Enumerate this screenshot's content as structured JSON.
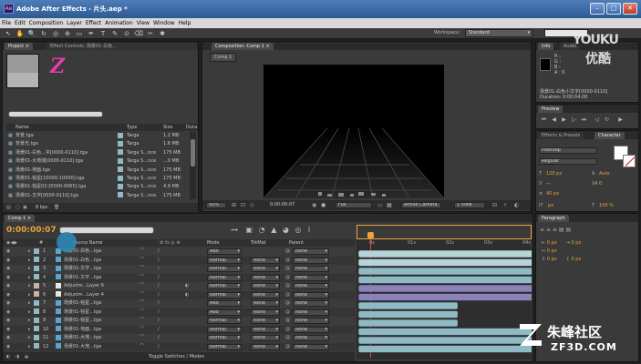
{
  "window": {
    "title": "Adobe After Effects - 片头.aep *",
    "app_icon": "Ae"
  },
  "menubar": {
    "items": [
      "File",
      "Edit",
      "Composition",
      "Layer",
      "Effect",
      "Animation",
      "View",
      "Window",
      "Help"
    ]
  },
  "toolbar": {
    "workspace_label": "Workspace:",
    "workspace_value": "Standard",
    "icons": [
      "selection-icon",
      "hand-icon",
      "zoom-icon",
      "rotate-icon",
      "camera-icon",
      "pan-behind-icon",
      "mask-icon",
      "pen-icon",
      "text-icon",
      "brush-icon",
      "clone-icon",
      "eraser-icon",
      "roto-icon",
      "puppet-icon"
    ]
  },
  "project_panel": {
    "tabs": [
      "Project ×",
      "Effect Controls: 场景01-白色..."
    ],
    "preview_glyph": "Z",
    "columns": [
      "Name",
      "Type",
      "Size",
      "Dura"
    ],
    "items": [
      {
        "name": "背景.tga",
        "type": "Targa",
        "size": "1.2 MB"
      },
      {
        "name": "背景光.tga",
        "type": "Targa",
        "size": "1.6 MB"
      },
      {
        "name": "场景01-白色...字[0000-0110].tga",
        "type": "Targa S...nce",
        "size": "175 MB"
      },
      {
        "name": "场景01-大地球[0000-0110].tga",
        "type": "Targa S...nce",
        "size": "...0 MB"
      },
      {
        "name": "场景01-地面.tga",
        "type": "Targa S...nce",
        "size": "175 MB"
      },
      {
        "name": "场景01-铭星[10000-10000].tga",
        "type": "Targa S...nce",
        "size": "175 MB"
      },
      {
        "name": "场景01-铭星02-[0000-0065].tga",
        "type": "Targa S...nce",
        "size": "4.9 MB"
      },
      {
        "name": "场景01-文字[0000-0110].tga",
        "type": "Targa S...nce",
        "size": "175 MB"
      }
    ],
    "footer_bpc": "8 bpc"
  },
  "composition_panel": {
    "tab": "Composition: Comp 1 ×",
    "sub_tab": "Comp 1",
    "zoom": "50%",
    "timecode": "0:00:00:07",
    "resolution": "Full",
    "camera": "Active Camera",
    "views": "1 View"
  },
  "info_panel": {
    "tabs": [
      "Info",
      "Audio"
    ],
    "lines": [
      "R :",
      "G :",
      "B :",
      "A : 0"
    ],
    "layer_name": "场景01-白色小文字[0000-0110]",
    "duration": "Duration: 0:00:04:00"
  },
  "preview_panel": {
    "tab": "Preview"
  },
  "effects_panel": {
    "tabs": [
      "Effects & Presets",
      "Character"
    ],
    "font_name": "Pixeloop",
    "font_style": "Regular",
    "size_value": "120 px",
    "leading_value": "Auto",
    "tracking_value": "0",
    "size2_value": "40 px",
    "percent": "100 %",
    "px_unit": "px"
  },
  "paragraph_panel": {
    "tab": "Paragraph",
    "values": [
      "0 px",
      "0 px",
      "0 px",
      "0 px",
      "0 px"
    ]
  },
  "timeline": {
    "tab": "Comp 1 ×",
    "timecode": "0:00:00:07",
    "col_headers": {
      "num": "#",
      "source": "Source Name",
      "mode": "Mode",
      "trkmat": "TrkMat",
      "parent": "Parent"
    },
    "ruler_marks": [
      "0s",
      "01s",
      "02s",
      "03s",
      "04s"
    ],
    "layers": [
      {
        "num": "1",
        "name": "场景01-白色...tga",
        "mode": "Add",
        "trk": "",
        "parent": "None",
        "color": "#5aa5d0",
        "bar_start": 0,
        "bar_end": 4.6
      },
      {
        "num": "2",
        "name": "场景01-白色...tga",
        "mode": "Normal",
        "trk": "None",
        "parent": "None",
        "color": "#5aa5d0",
        "bar_start": 0,
        "bar_end": 4.6
      },
      {
        "num": "3",
        "name": "场景01-文字...tga",
        "mode": "Normal",
        "trk": "None",
        "parent": "None",
        "color": "#5aa5d0",
        "bar_start": 0,
        "bar_end": 4.6
      },
      {
        "num": "4",
        "name": "场景01-文字...tga",
        "mode": "Normal",
        "trk": "None",
        "parent": "None",
        "color": "#5aa5d0",
        "bar_start": 0,
        "bar_end": 4.6
      },
      {
        "num": "5",
        "name": "Adjustm...Layer 6",
        "mode": "Normal",
        "trk": "None",
        "parent": "None",
        "color": "#e6e6e6",
        "bar_start": 0,
        "bar_end": 4.6
      },
      {
        "num": "6",
        "name": "Adjustm...Layer 4",
        "mode": "Normal",
        "trk": "None",
        "parent": "None",
        "color": "#e6e6e6",
        "bar_start": 0,
        "bar_end": 4.6
      },
      {
        "num": "7",
        "name": "场景01-铭星...tga",
        "mode": "Add",
        "trk": "None",
        "parent": "None",
        "color": "#5aa5d0",
        "bar_start": 0,
        "bar_end": 2.6
      },
      {
        "num": "8",
        "name": "场景01-铭星...tga",
        "mode": "Add",
        "trk": "None",
        "parent": "None",
        "color": "#5aa5d0",
        "bar_start": 0,
        "bar_end": 2.6
      },
      {
        "num": "9",
        "name": "场景01-铭星...tga",
        "mode": "Normal",
        "trk": "None",
        "parent": "None",
        "color": "#5aa5d0",
        "bar_start": 0,
        "bar_end": 2.6
      },
      {
        "num": "10",
        "name": "场景01-地面...tga",
        "mode": "Normal",
        "trk": "None",
        "parent": "None",
        "color": "#5aa5d0",
        "bar_start": 0,
        "bar_end": 4.6
      },
      {
        "num": "11",
        "name": "场景01-大地...tga",
        "mode": "Normal",
        "trk": "None",
        "parent": "None",
        "color": "#5aa5d0",
        "bar_start": 0,
        "bar_end": 4.6
      },
      {
        "num": "12",
        "name": "场景01-大地...tga",
        "mode": "Normal",
        "trk": "None",
        "parent": "None",
        "color": "#5aa5d0",
        "bar_start": 0,
        "bar_end": 4.6
      }
    ],
    "footer_label": "Toggle Switches / Modes"
  },
  "watermarks": {
    "youku_en": "YOUKU",
    "youku_cn": "优酷",
    "zf3d_cn": "朱峰社区",
    "zf3d_en": "ZF3D.COM"
  },
  "colors": {
    "accent_orange": "#e8a43a",
    "title_blue": "#3a6aa5",
    "layer_blue": "#5aa5d0",
    "layer_purple": "#8a82b8",
    "layer_teal": "#8fb9c4"
  }
}
